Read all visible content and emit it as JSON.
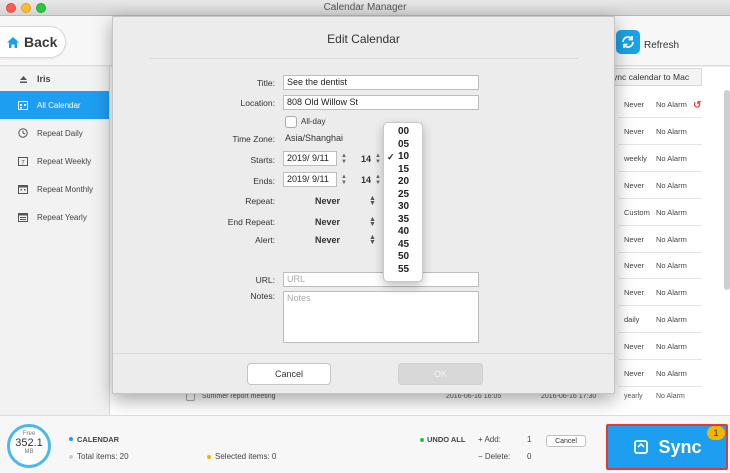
{
  "window": {
    "title": "Calendar Manager"
  },
  "toolbar": {
    "back_label": "Back",
    "refresh_label": "Refresh",
    "sync_calendar_tab": "ync calendar to Mac"
  },
  "sidebar": {
    "owner": "Iris",
    "items": [
      {
        "label": "All Calendar",
        "icon": "calendar-grid-icon",
        "active": true
      },
      {
        "label": "Repeat Daily",
        "icon": "clock-icon"
      },
      {
        "label": "Repeat Weekly",
        "icon": "calendar-7-icon"
      },
      {
        "label": "Repeat Monthly",
        "icon": "calendar-month-icon"
      },
      {
        "label": "Repeat Yearly",
        "icon": "calendar-year-icon"
      }
    ]
  },
  "table": {
    "rows": [
      {
        "repeat": "Never",
        "alarm": "No Alarm"
      },
      {
        "repeat": "Never",
        "alarm": "No Alarm"
      },
      {
        "repeat": "weekly",
        "alarm": "No Alarm"
      },
      {
        "repeat": "Never",
        "alarm": "No Alarm"
      },
      {
        "repeat": "Custom",
        "alarm": "No Alarm"
      },
      {
        "repeat": "Never",
        "alarm": "No Alarm"
      },
      {
        "repeat": "Never",
        "alarm": "No Alarm"
      },
      {
        "repeat": "Never",
        "alarm": "No Alarm"
      },
      {
        "repeat": "daily",
        "alarm": "No Alarm"
      },
      {
        "repeat": "Never",
        "alarm": "No Alarm"
      },
      {
        "repeat": "Never",
        "alarm": "No Alarm"
      }
    ],
    "last_row": {
      "title": "Summer report meeting",
      "start": "2016-06-16 16:05",
      "end": "2016-06-16 17:30",
      "repeat": "yearly",
      "alarm": "No Alarm"
    }
  },
  "dialog": {
    "title": "Edit Calendar",
    "title_label": "Title:",
    "title_value": "See the dentist",
    "location_label": "Location:",
    "location_value": "808 Old Willow St",
    "allday_label": "All-day",
    "timezone_label": "Time Zone:",
    "timezone_value": "Asia/Shanghai",
    "starts_label": "Starts:",
    "starts_date": "2019/  9/11",
    "starts_hour": "14",
    "ends_label": "Ends:",
    "ends_date": "2019/  9/11",
    "ends_hour": "14",
    "repeat_label": "Repeat:",
    "repeat_value": "Never",
    "end_repeat_label": "End Repeat:",
    "end_repeat_value": "Never",
    "alert_label": "Alert:",
    "alert_value": "Never",
    "url_label": "URL:",
    "url_placeholder": "URL",
    "notes_label": "Notes:",
    "notes_placeholder": "Notes",
    "cancel_label": "Cancel",
    "ok_label": "OK",
    "minutes_options": [
      "00",
      "05",
      "10",
      "15",
      "20",
      "25",
      "30",
      "35",
      "40",
      "45",
      "50",
      "55"
    ],
    "minutes_selected": "10"
  },
  "bottom": {
    "storage_free_label": "Free",
    "storage_value": "352.1",
    "storage_unit": "MB",
    "calendar_label": "CALENDAR",
    "total_items": "Total items: 20",
    "selected_items": "Selected items: 0",
    "undo_all": "UNDO ALL",
    "add_label": "+ Add:",
    "add_count": "1",
    "delete_label": "− Delete:",
    "delete_count": "0",
    "cancel_label": "Cancel",
    "sync_label": "Sync",
    "sync_badge": "1"
  },
  "colors": {
    "accent": "#1e9ef0",
    "highlight_border": "#e53935",
    "badge": "#f6b300",
    "undo": "#e24141"
  }
}
